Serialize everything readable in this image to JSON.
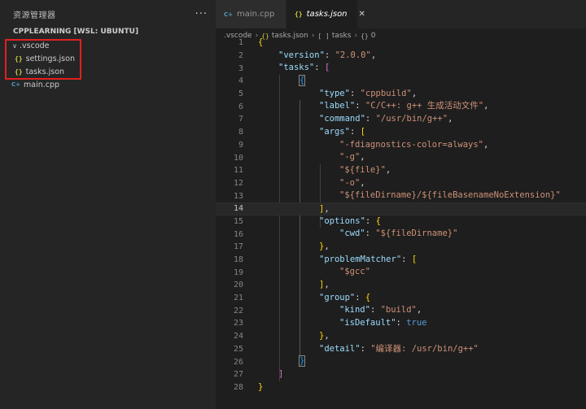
{
  "sidebar": {
    "title": "资源管理器",
    "more": "···",
    "section": "CPPLEARNING [WSL: UBUNTU]",
    "items": [
      {
        "label": ".vscode",
        "type": "folder"
      },
      {
        "label": "settings.json",
        "type": "json"
      },
      {
        "label": "tasks.json",
        "type": "json"
      },
      {
        "label": "main.cpp",
        "type": "cpp"
      }
    ]
  },
  "icons": {
    "json": "{}",
    "cpp": "C+",
    "chevron": "∨",
    "close": "✕",
    "breadcrumb_sep": "›",
    "array": "[ ]",
    "object": "{}"
  },
  "tabs": [
    {
      "label": "main.cpp",
      "active": false
    },
    {
      "label": "tasks.json",
      "active": true
    }
  ],
  "breadcrumb": {
    "folder": ".vscode",
    "file": "tasks.json",
    "node1": "tasks",
    "node2": "0"
  },
  "colors": {
    "accent_box": "#e0211f",
    "key": "#9cdcfe",
    "string": "#ce9178",
    "bracket_gold": "#ffd700",
    "bracket_purple": "#da70d6",
    "bracket_blue": "#179fff",
    "keyword": "#569cd6"
  },
  "code": {
    "current_line": 14,
    "lines": [
      {
        "n": "1"
      },
      {
        "n": "2"
      },
      {
        "n": "3"
      },
      {
        "n": "4"
      },
      {
        "n": "5"
      },
      {
        "n": "6"
      },
      {
        "n": "7"
      },
      {
        "n": "8"
      },
      {
        "n": "9"
      },
      {
        "n": "10"
      },
      {
        "n": "11"
      },
      {
        "n": "12"
      },
      {
        "n": "13"
      },
      {
        "n": "14"
      },
      {
        "n": "15"
      },
      {
        "n": "16"
      },
      {
        "n": "17"
      },
      {
        "n": "18"
      },
      {
        "n": "19"
      },
      {
        "n": "20"
      },
      {
        "n": "21"
      },
      {
        "n": "22"
      },
      {
        "n": "23"
      },
      {
        "n": "24"
      },
      {
        "n": "25"
      },
      {
        "n": "26"
      },
      {
        "n": "27"
      },
      {
        "n": "28"
      }
    ],
    "t": {
      "version_key": "\"version\"",
      "version_val": "\"2.0.0\"",
      "tasks_key": "\"tasks\"",
      "type_key": "\"type\"",
      "type_val": "\"cppbuild\"",
      "label_key": "\"label\"",
      "label_val": "\"C/C++: g++ 生成活动文件\"",
      "command_key": "\"command\"",
      "command_val": "\"/usr/bin/g++\"",
      "args_key": "\"args\"",
      "arg1": "\"-fdiagnostics-color=always\"",
      "arg2": "\"-g\"",
      "arg3": "\"${file}\"",
      "arg4": "\"-o\"",
      "arg5": "\"${fileDirname}/${fileBasenameNoExtension}\"",
      "options_key": "\"options\"",
      "cwd_key": "\"cwd\"",
      "cwd_val": "\"${fileDirname}\"",
      "pm_key": "\"problemMatcher\"",
      "pm_val": "\"$gcc\"",
      "group_key": "\"group\"",
      "kind_key": "\"kind\"",
      "kind_val": "\"build\"",
      "isdefault_key": "\"isDefault\"",
      "isdefault_val": "true",
      "detail_key": "\"detail\"",
      "detail_val": "\"编译器: /usr/bin/g++\""
    }
  }
}
